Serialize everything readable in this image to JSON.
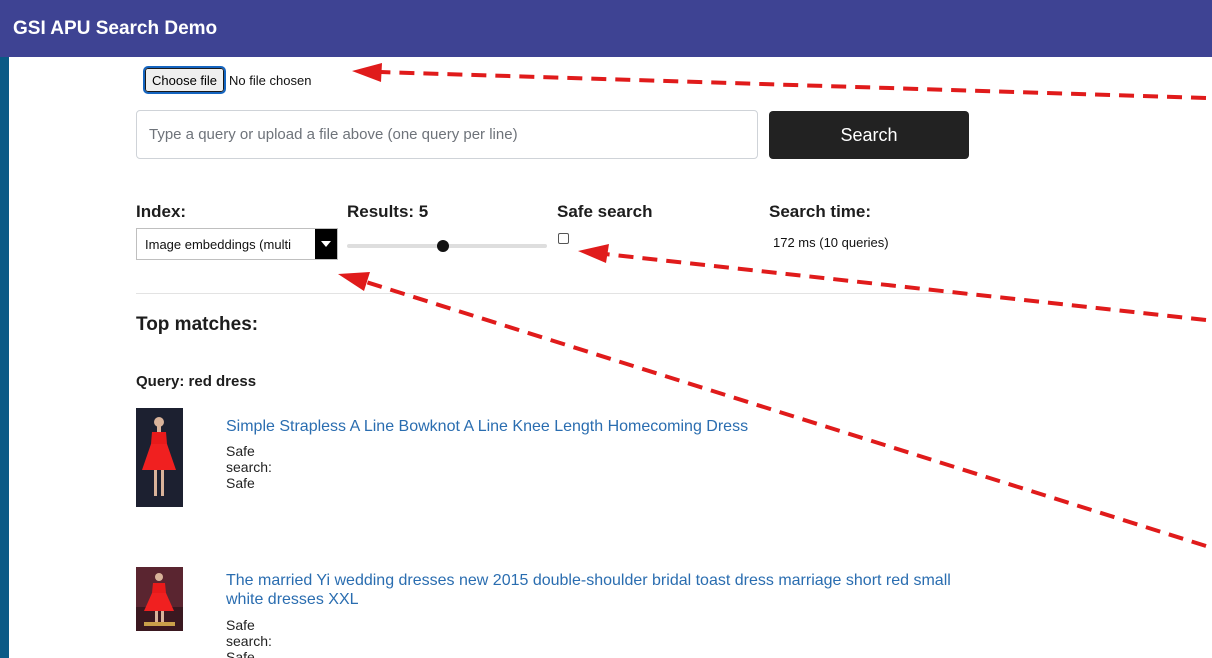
{
  "app": {
    "title": "GSI APU Search Demo"
  },
  "file_input": {
    "button_label": "Choose file",
    "status": "No file chosen"
  },
  "search": {
    "placeholder": "Type a query or upload a file above (one query per line)",
    "button_label": "Search"
  },
  "controls": {
    "index_label": "Index:",
    "index_value": "Image embeddings (multi",
    "results_label": "Results: 5",
    "results_fraction": 0.48,
    "safe_search_label": "Safe search",
    "safe_search_checked": false,
    "search_time_label": "Search time:",
    "search_time_value": "172 ms (10 queries)"
  },
  "results": {
    "heading": "Top matches:",
    "query_label": "Query: red dress",
    "items": [
      {
        "title": "Simple Strapless A Line Bowknot A Line Knee Length Homecoming Dress",
        "safe": "Safe search: Safe"
      },
      {
        "title": "The married Yi wedding dresses new 2015 double-shoulder bridal toast dress marriage short red small white dresses XXL",
        "safe": "Safe search: Safe"
      }
    ]
  },
  "colors": {
    "header": "#3e4393",
    "frame": "#0b5a86",
    "link": "#2a6db0",
    "annotation": "#e01b1b"
  }
}
